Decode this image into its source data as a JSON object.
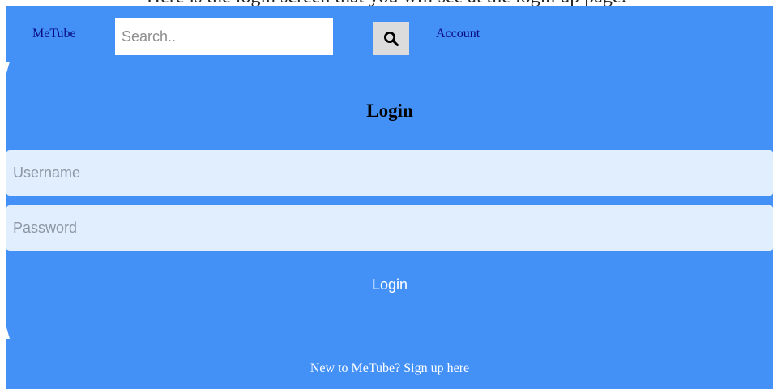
{
  "caption": "Here is the login screen that you will see at the login up page:",
  "nav": {
    "brand": "MeTube",
    "search_placeholder": "Search..",
    "search_icon": "search-icon",
    "account": "Account"
  },
  "login": {
    "title": "Login",
    "username_placeholder": "Username",
    "password_placeholder": "Password",
    "button_label": "Login",
    "signup_link": "New to MeTube? Sign up here"
  },
  "colors": {
    "panel": "#4391f7",
    "field": "#e1eefd",
    "link": "#0a0a80",
    "search_button": "#dcdcdc"
  }
}
